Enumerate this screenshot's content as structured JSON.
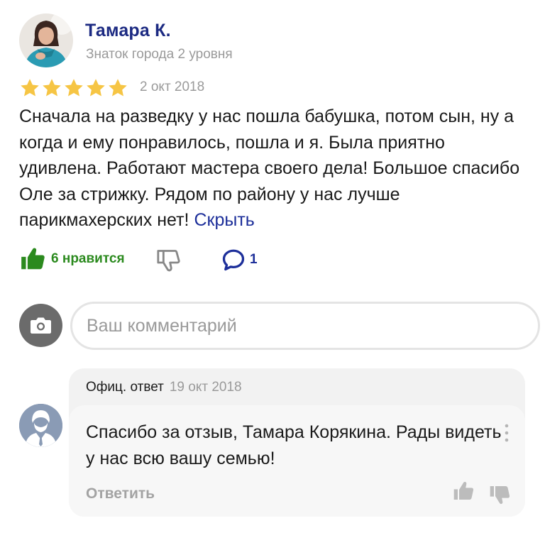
{
  "review": {
    "author_name": "Тамара К.",
    "author_level": "Знаток города 2 уровня",
    "rating": 5,
    "date": "2 окт 2018",
    "text": "Сначала на разведку у нас пошла бабушка, потом сын, ну а когда и ему понравилось, пошла и я. Была приятно удивлена. Работают мастера своего дела! Большое спасибо Оле за стрижку. Рядом по району у нас лучше парикмахерских нет!",
    "hide_link": "Скрыть",
    "likes_label": "6 нравится",
    "comments_count": "1"
  },
  "comment_box": {
    "placeholder": "Ваш комментарий"
  },
  "official_reply": {
    "label": "Офиц. ответ",
    "date": "19 окт 2018",
    "text": "Спасибо за отзыв, Тамара Корякина. Рады видеть у нас всю вашу семью!",
    "reply_action": "Ответить"
  },
  "colors": {
    "author_name": "#1c2a82",
    "link": "#1d2f9a",
    "like": "#2b8a1e",
    "star": "#f6c544",
    "muted": "#9a9a9a"
  },
  "icons": {
    "avatar": "user-photo",
    "star": "star-icon",
    "like": "thumbs-up-icon",
    "dislike": "thumbs-down-icon",
    "comment": "speech-bubble-icon",
    "camera": "camera-icon",
    "org_avatar": "business-person-icon",
    "more": "vertical-dots-icon"
  }
}
